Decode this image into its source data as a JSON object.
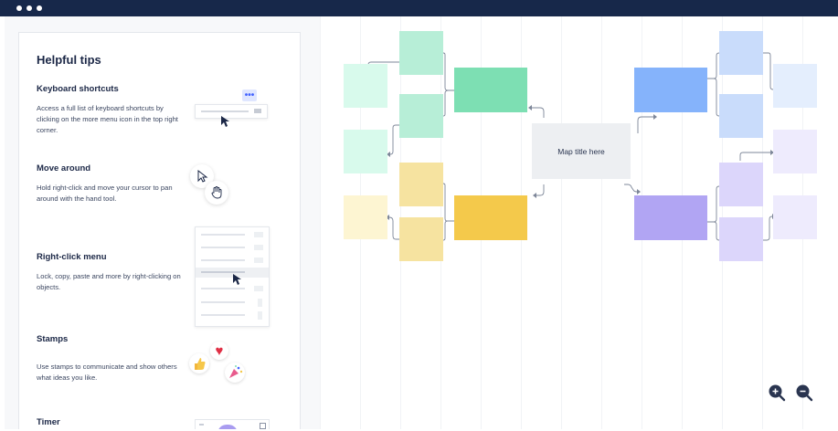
{
  "panel": {
    "title": "Helpful tips",
    "tips": [
      {
        "title": "Keyboard shortcuts",
        "desc": "Access a full list of keyboard shortcuts by clicking on the more menu icon in the top right corner."
      },
      {
        "title": "Move around",
        "desc": "Hold right-click and move your cursor to pan around with the hand tool."
      },
      {
        "title": "Right-click menu",
        "desc": "Lock, copy, paste and more by right-clicking on objects."
      },
      {
        "title": "Stamps",
        "desc": "Use stamps to communicate and show others what ideas you like."
      },
      {
        "title": "Timer",
        "desc": ""
      }
    ]
  },
  "mindmap": {
    "central_title": "Map title here"
  },
  "icons": {
    "more": "more-icon",
    "zoom_in": "zoom-in-icon",
    "zoom_out": "zoom-out-icon"
  },
  "colors": {
    "titlebar": "#17284a",
    "accent": "#4262ff"
  }
}
